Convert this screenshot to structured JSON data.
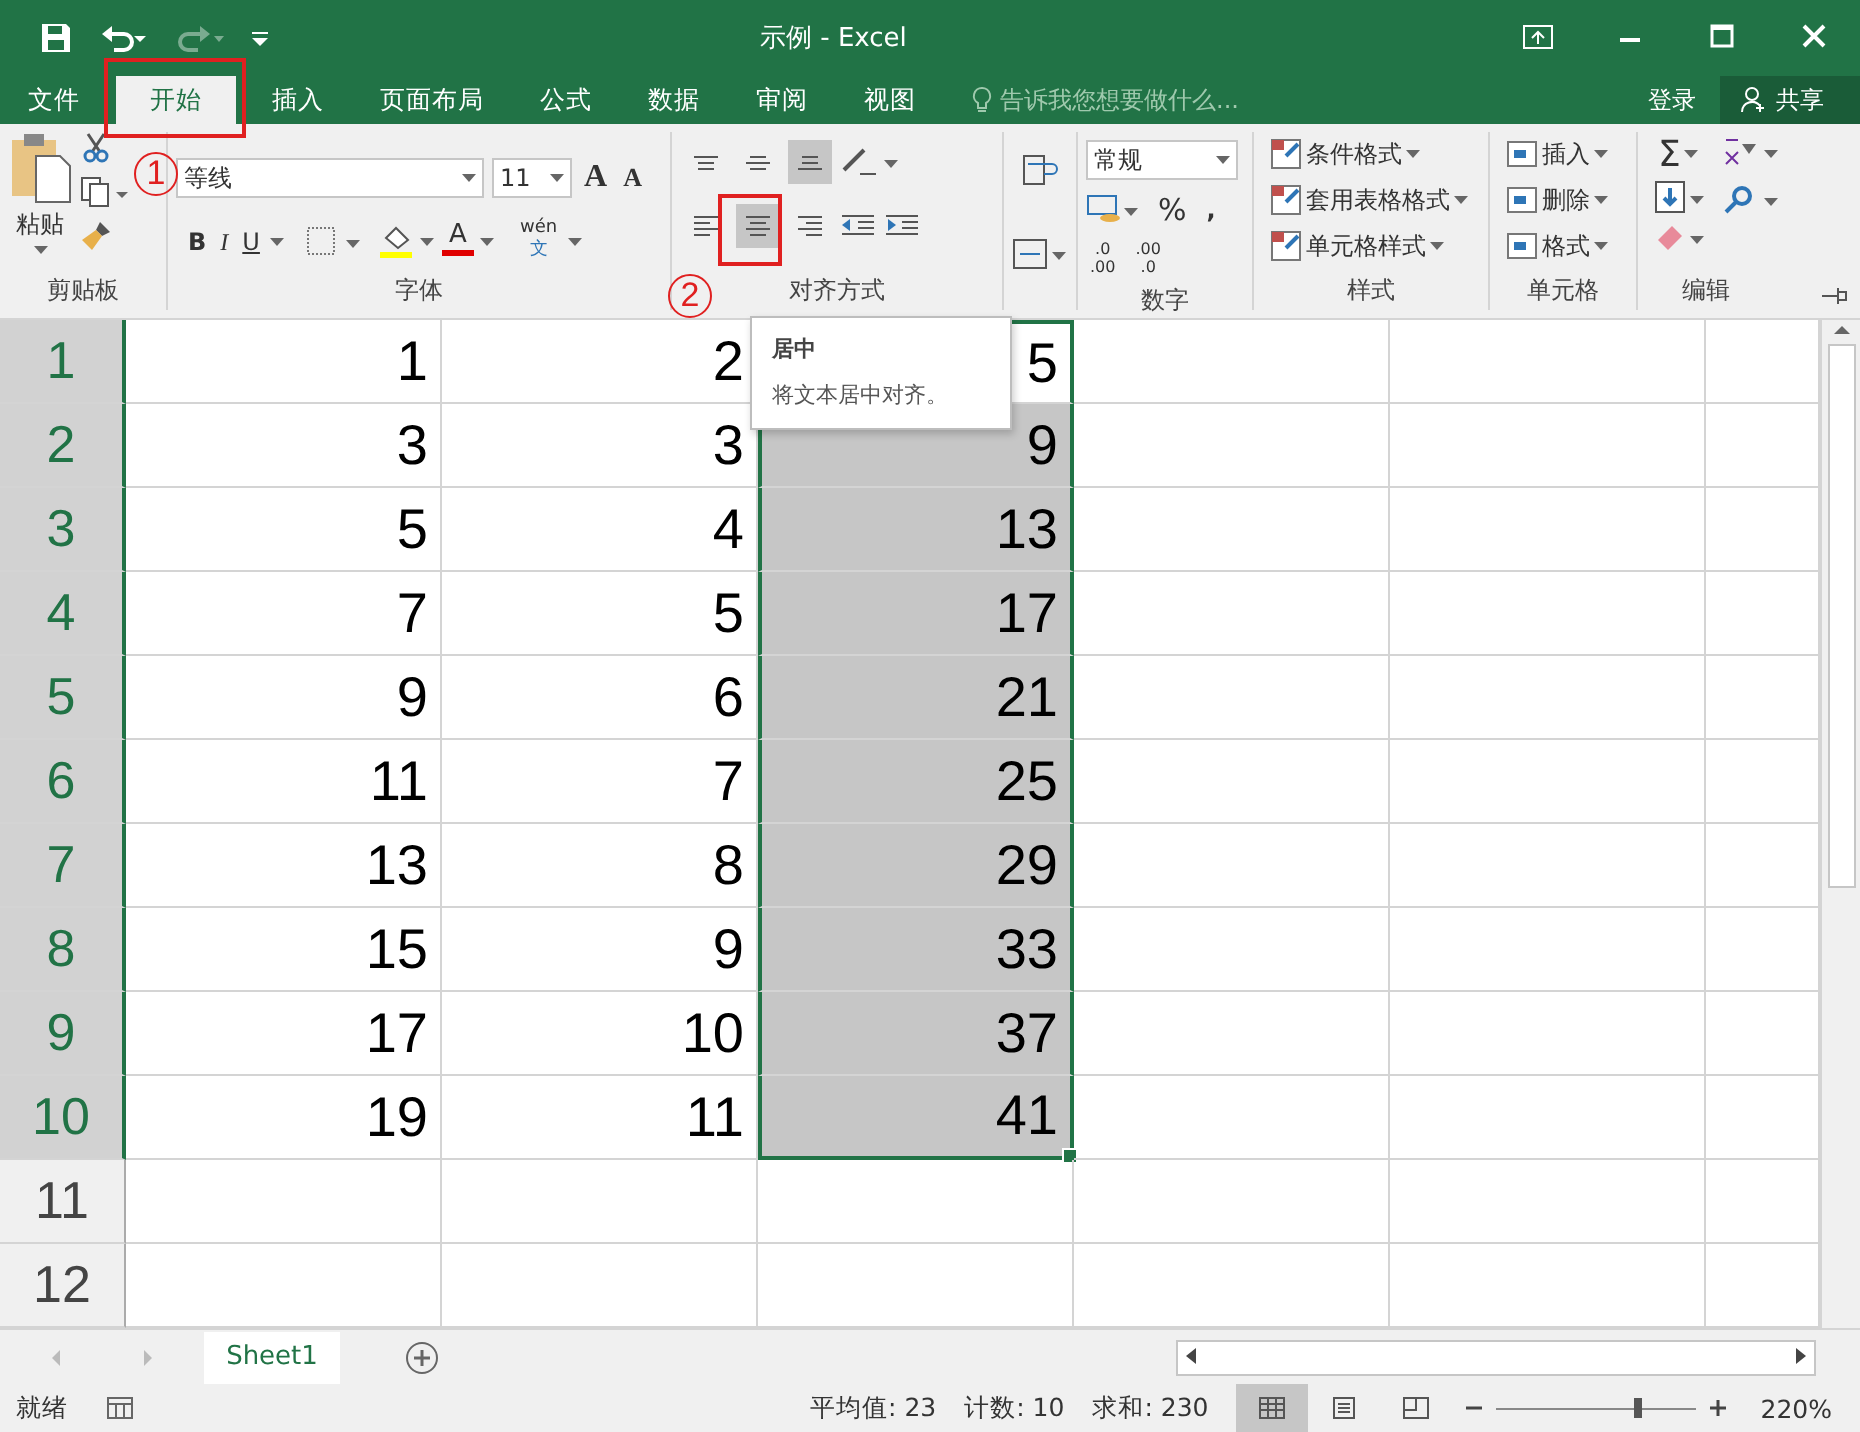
{
  "window": {
    "title": "示例 - Excel",
    "redo_disabled": true
  },
  "tabs": [
    {
      "label": "文件",
      "selected": false
    },
    {
      "label": "开始",
      "selected": true
    },
    {
      "label": "插入",
      "selected": false
    },
    {
      "label": "页面布局",
      "selected": false
    },
    {
      "label": "公式",
      "selected": false
    },
    {
      "label": "数据",
      "selected": false
    },
    {
      "label": "审阅",
      "selected": false
    },
    {
      "label": "视图",
      "selected": false
    }
  ],
  "tell_me": {
    "placeholder": "告诉我您想要做什么..."
  },
  "sign_in": "登录",
  "share": "共享",
  "ribbon": {
    "clipboard": {
      "label": "剪贴板",
      "paste": "粘贴"
    },
    "font": {
      "label": "字体",
      "font_name": "等线",
      "font_size": "11",
      "grow": "A",
      "shrink": "A",
      "bold": "B",
      "italic": "I",
      "underline": "U",
      "font_color": "A",
      "phonetic_top": "wén",
      "phonetic_bottom": "文"
    },
    "alignment": {
      "label": "对齐方式",
      "vertical": [
        {
          "kind": "top",
          "selected": false
        },
        {
          "kind": "middle",
          "selected": false
        },
        {
          "kind": "bottom",
          "selected": true
        }
      ],
      "horizontal": [
        {
          "kind": "left",
          "selected": false
        },
        {
          "kind": "center",
          "selected": true
        },
        {
          "kind": "right",
          "selected": false
        }
      ]
    },
    "number": {
      "label": "数字",
      "format": "常规",
      "percent": "%",
      "comma": ",",
      "inc_decimal": [
        ".0",
        ".00"
      ],
      "dec_decimal": [
        ".00",
        ".0"
      ]
    },
    "styles": {
      "label": "样式",
      "items": [
        "条件格式",
        "套用表格格式",
        "单元格样式"
      ]
    },
    "cells": {
      "label": "单元格",
      "items": [
        "插入",
        "删除",
        "格式"
      ]
    },
    "editing": {
      "label": "编辑",
      "sum": "Σ"
    }
  },
  "annotations": [
    {
      "label": "1"
    },
    {
      "label": "2"
    }
  ],
  "tooltip": {
    "title": "居中",
    "body": "将文本居中对齐。"
  },
  "grid": {
    "rows": [
      {
        "header": "1",
        "selected": true,
        "cells": [
          {
            "text": "1",
            "selected": false,
            "active": false
          },
          {
            "text": "2",
            "selected": false,
            "active": false
          },
          {
            "text": "5",
            "selected": true,
            "active": true
          }
        ]
      },
      {
        "header": "2",
        "selected": true,
        "cells": [
          {
            "text": "3",
            "selected": false,
            "active": false
          },
          {
            "text": "3",
            "selected": false,
            "active": false
          },
          {
            "text": "9",
            "selected": true,
            "active": false
          }
        ]
      },
      {
        "header": "3",
        "selected": true,
        "cells": [
          {
            "text": "5",
            "selected": false,
            "active": false
          },
          {
            "text": "4",
            "selected": false,
            "active": false
          },
          {
            "text": "13",
            "selected": true,
            "active": false
          }
        ]
      },
      {
        "header": "4",
        "selected": true,
        "cells": [
          {
            "text": "7",
            "selected": false,
            "active": false
          },
          {
            "text": "5",
            "selected": false,
            "active": false
          },
          {
            "text": "17",
            "selected": true,
            "active": false
          }
        ]
      },
      {
        "header": "5",
        "selected": true,
        "cells": [
          {
            "text": "9",
            "selected": false,
            "active": false
          },
          {
            "text": "6",
            "selected": false,
            "active": false
          },
          {
            "text": "21",
            "selected": true,
            "active": false
          }
        ]
      },
      {
        "header": "6",
        "selected": true,
        "cells": [
          {
            "text": "11",
            "selected": false,
            "active": false
          },
          {
            "text": "7",
            "selected": false,
            "active": false
          },
          {
            "text": "25",
            "selected": true,
            "active": false
          }
        ]
      },
      {
        "header": "7",
        "selected": true,
        "cells": [
          {
            "text": "13",
            "selected": false,
            "active": false
          },
          {
            "text": "8",
            "selected": false,
            "active": false
          },
          {
            "text": "29",
            "selected": true,
            "active": false
          }
        ]
      },
      {
        "header": "8",
        "selected": true,
        "cells": [
          {
            "text": "15",
            "selected": false,
            "active": false
          },
          {
            "text": "9",
            "selected": false,
            "active": false
          },
          {
            "text": "33",
            "selected": true,
            "active": false
          }
        ]
      },
      {
        "header": "9",
        "selected": true,
        "cells": [
          {
            "text": "17",
            "selected": false,
            "active": false
          },
          {
            "text": "10",
            "selected": false,
            "active": false
          },
          {
            "text": "37",
            "selected": true,
            "active": false
          }
        ]
      },
      {
        "header": "10",
        "selected": true,
        "cells": [
          {
            "text": "19",
            "selected": false,
            "active": false
          },
          {
            "text": "11",
            "selected": false,
            "active": false
          },
          {
            "text": "41",
            "selected": true,
            "active": false
          }
        ]
      },
      {
        "header": "11",
        "selected": false,
        "cells": []
      },
      {
        "header": "12",
        "selected": false,
        "cells": []
      }
    ]
  },
  "sheets": [
    {
      "label": "Sheet1",
      "selected": true
    }
  ],
  "status_bar": {
    "ready": "就绪",
    "average": "平均值: 23",
    "count": "计数: 10",
    "sum": "求和: 230",
    "views": [
      {
        "kind": "normal",
        "selected": true
      },
      {
        "kind": "page_layout",
        "selected": false
      },
      {
        "kind": "page_break",
        "selected": false
      }
    ],
    "zoom": {
      "level": 0.71,
      "reading": "220%"
    }
  }
}
